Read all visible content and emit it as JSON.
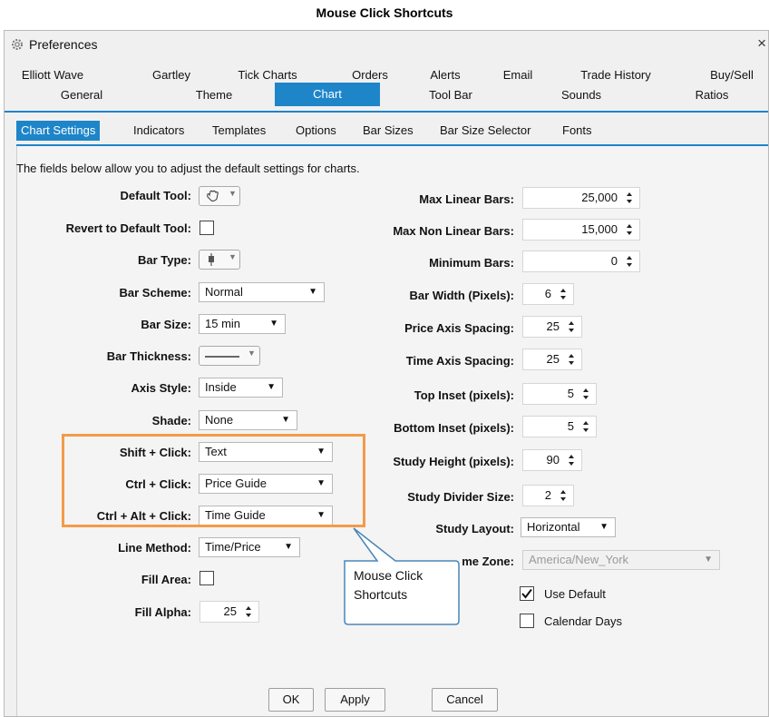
{
  "caption": "Mouse Click Shortcuts",
  "window": {
    "title": "Preferences",
    "close": "×"
  },
  "tabs_row1": [
    "Elliott Wave",
    "Gartley",
    "Tick Charts",
    "Orders",
    "Alerts",
    "Email",
    "Trade History",
    "Buy/Sell"
  ],
  "tabs_row2": [
    "General",
    "Theme",
    "Chart",
    "Tool Bar",
    "Sounds",
    "Ratios"
  ],
  "selected_tab": "Chart",
  "subtabs": [
    "Chart Settings",
    "Indicators",
    "Templates",
    "Options",
    "Bar Sizes",
    "Bar Size Selector",
    "Fonts"
  ],
  "selected_subtab": "Chart Settings",
  "intro": "The fields below allow you to adjust the default settings for charts.",
  "left": {
    "default_tool": "Default Tool:",
    "revert": "Revert to Default Tool:",
    "bar_type": "Bar Type:",
    "bar_scheme": {
      "label": "Bar Scheme:",
      "value": "Normal"
    },
    "bar_size": {
      "label": "Bar Size:",
      "value": "15 min"
    },
    "bar_thickness": "Bar Thickness:",
    "axis_style": {
      "label": "Axis Style:",
      "value": "Inside"
    },
    "shade": {
      "label": "Shade:",
      "value": "None"
    },
    "shift_click": {
      "label": "Shift + Click:",
      "value": "Text"
    },
    "ctrl_click": {
      "label": "Ctrl + Click:",
      "value": "Price Guide"
    },
    "ctrl_alt_click": {
      "label": "Ctrl + Alt + Click:",
      "value": "Time Guide"
    },
    "line_method": {
      "label": "Line Method:",
      "value": "Time/Price"
    },
    "fill_area": "Fill Area:",
    "fill_alpha": {
      "label": "Fill Alpha:",
      "value": "25"
    }
  },
  "right": {
    "max_linear": {
      "label": "Max Linear Bars:",
      "value": "25,000"
    },
    "max_non_linear": {
      "label": "Max Non Linear Bars:",
      "value": "15,000"
    },
    "minimum_bars": {
      "label": "Minimum Bars:",
      "value": "0"
    },
    "bar_width": {
      "label": "Bar Width (Pixels):",
      "value": "6"
    },
    "price_axis": {
      "label": "Price Axis Spacing:",
      "value": "25"
    },
    "time_axis": {
      "label": "Time Axis Spacing:",
      "value": "25"
    },
    "top_inset": {
      "label": "Top Inset (pixels):",
      "value": "5"
    },
    "bottom_inset": {
      "label": "Bottom Inset (pixels):",
      "value": "5"
    },
    "study_height": {
      "label": "Study Height (pixels):",
      "value": "90"
    },
    "study_divider": {
      "label": "Study Divider Size:",
      "value": "2"
    },
    "study_layout": {
      "label": "Study Layout:",
      "value": "Horizontal"
    },
    "time_zone": {
      "label_visible": "me Zone:",
      "value": "America/New_York"
    },
    "use_default": {
      "label": "Use Default",
      "checked": true
    },
    "calendar_days": {
      "label": "Calendar Days",
      "checked": false
    }
  },
  "callout": {
    "line1": "Mouse Click",
    "line2": "Shortcuts"
  },
  "buttons": {
    "ok": "OK",
    "apply": "Apply",
    "cancel": "Cancel"
  },
  "colors": {
    "accent": "#1e85c9",
    "highlight": "#f39b4a",
    "callout_border": "#4a86b8"
  }
}
